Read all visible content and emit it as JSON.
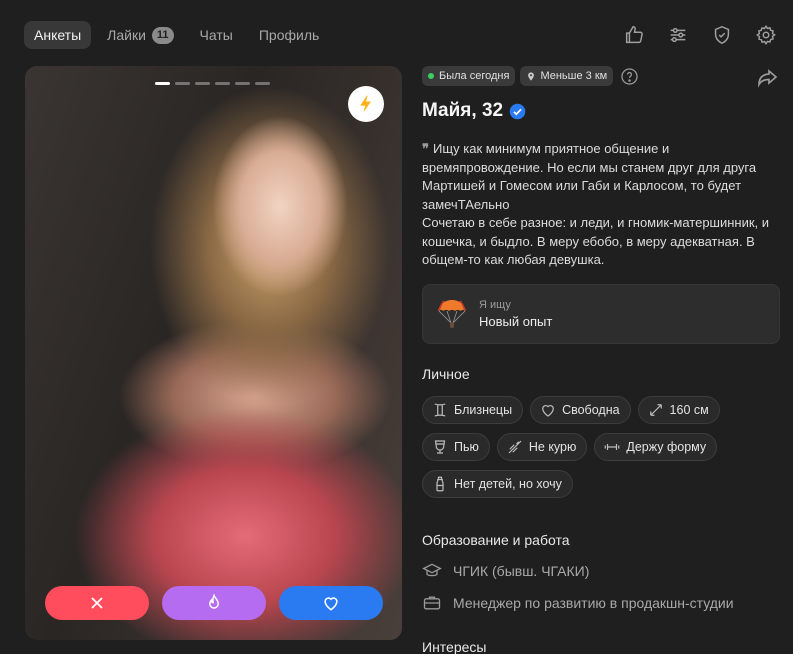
{
  "nav": {
    "tabs": [
      {
        "label": "Анкеты"
      },
      {
        "label": "Лайки",
        "badge": "11"
      },
      {
        "label": "Чаты"
      },
      {
        "label": "Профиль"
      }
    ],
    "icons": [
      "like-icon",
      "filters-icon",
      "shield-icon",
      "gear-icon"
    ]
  },
  "profile": {
    "status_online": "Была сегодня",
    "distance": "Меньше 3 км",
    "name_age": "Майя, 32",
    "bio": "Ищу как минимум приятное общение и времяпровождение. Но если мы станем друг для друга Мартишей и Гомесом или Габи и Карлосом, то будет замечТАельно\nСочетаю в себе разное: и леди, и гномик-матершинник, и кошечка, и быдло. В меру ебобо, в меру адекватная. В общем-то как любая девушка.",
    "seeking_label": "Я ищу",
    "seeking_value": "Новый опыт",
    "photos_count": 6,
    "photo_active": 1
  },
  "personal": {
    "title": "Личное",
    "chips": [
      {
        "icon": "gemini-icon",
        "label": "Близнецы"
      },
      {
        "icon": "heart-icon",
        "label": "Свободна"
      },
      {
        "icon": "height-icon",
        "label": "160 см"
      },
      {
        "icon": "glass-icon",
        "label": "Пью"
      },
      {
        "icon": "no-smoking-icon",
        "label": "Не курю"
      },
      {
        "icon": "dumbbell-icon",
        "label": "Держу форму"
      },
      {
        "icon": "baby-bottle-icon",
        "label": "Нет детей, но хочу"
      }
    ]
  },
  "education": {
    "title": "Образование и работа",
    "school": "ЧГИК (бывш. ЧГАКИ)",
    "job": "Менеджер по развитию в продакшн-студии"
  },
  "interests": {
    "title": "Интересы"
  },
  "colors": {
    "accent_red": "#ff4d5e",
    "accent_purple": "#b56cf0",
    "accent_blue": "#2a7af2",
    "online_green": "#3ccf61"
  }
}
